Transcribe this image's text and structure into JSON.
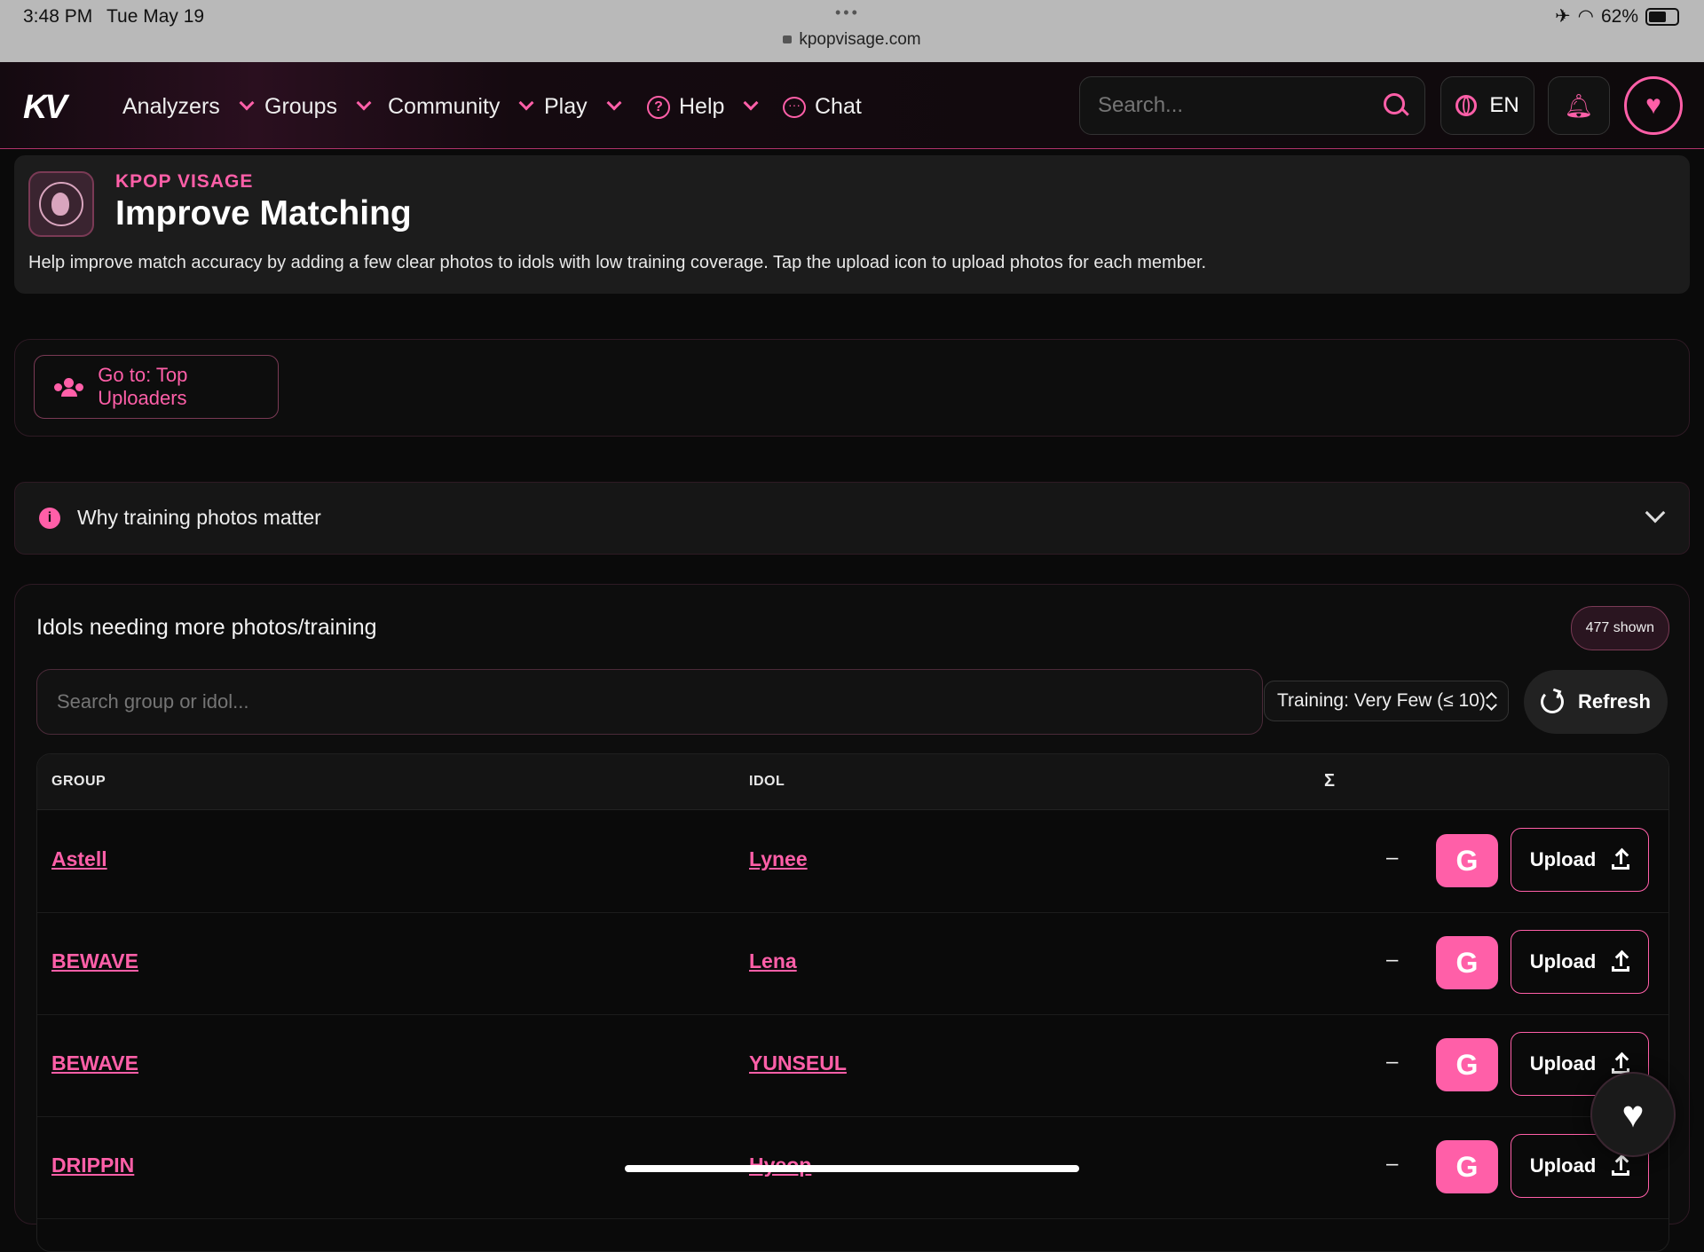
{
  "status_bar": {
    "time": "3:48 PM",
    "date": "Tue May 19",
    "url": "kpopvisage.com",
    "battery": "62%"
  },
  "nav": {
    "logo": "KV",
    "items": [
      {
        "label": "Analyzers"
      },
      {
        "label": "Groups"
      },
      {
        "label": "Community"
      },
      {
        "label": "Play"
      },
      {
        "label": "Help"
      },
      {
        "label": "Chat"
      }
    ],
    "search_placeholder": "Search...",
    "language": "EN"
  },
  "header": {
    "eyebrow": "KPOP VISAGE",
    "title": "Improve Matching",
    "description": "Help improve match accuracy by adding a few clear photos to idols with low training coverage. Tap the upload icon to upload photos for each member."
  },
  "uploaders_button": "Go to: Top Uploaders",
  "why_section": {
    "label": "Why training photos matter"
  },
  "panel": {
    "title": "Idols needing more photos/training",
    "count_badge": "477 shown",
    "search_placeholder": "Search group or idol...",
    "training_filter": "Training: Very Few (≤ 10)",
    "refresh_label": "Refresh",
    "columns": {
      "group": "GROUP",
      "idol": "IDOL",
      "sum": "Σ"
    },
    "rows": [
      {
        "group": "Astell",
        "idol": "Lynee",
        "count": "–",
        "google": "G",
        "upload": "Upload"
      },
      {
        "group": "BEWAVE",
        "idol": "Lena",
        "count": "–",
        "google": "G",
        "upload": "Upload"
      },
      {
        "group": "BEWAVE",
        "idol": "YUNSEUL",
        "count": "–",
        "google": "G",
        "upload": "Upload"
      },
      {
        "group": "DRIPPIN",
        "idol": "Hyeop",
        "count": "–",
        "google": "G",
        "upload": "Upload"
      }
    ]
  },
  "colors": {
    "accent": "#ff5fa8",
    "background": "#0a0a0a",
    "card": "#1c1c1c"
  }
}
